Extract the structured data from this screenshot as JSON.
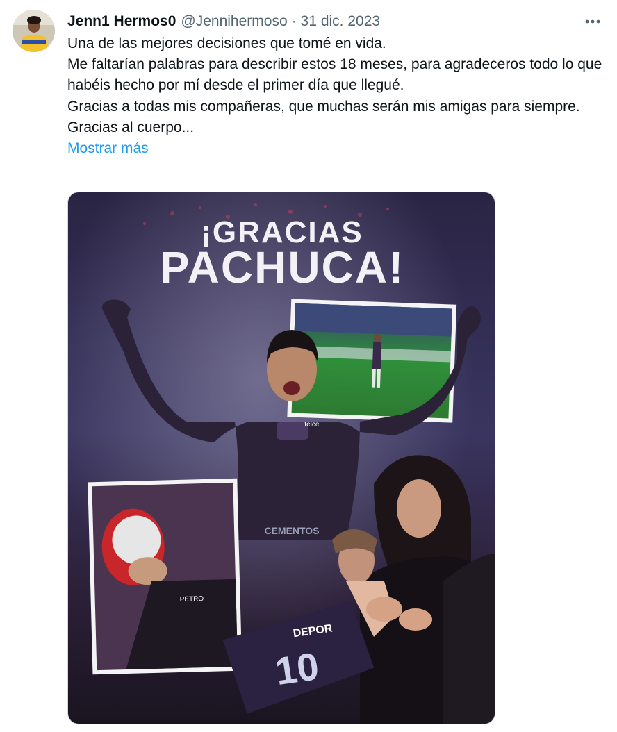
{
  "tweet": {
    "display_name": "Jenn1 Hermos0",
    "handle": "@Jennihermoso",
    "separator": "·",
    "date": "31 dic. 2023",
    "more_icon": "more-horizontal-icon",
    "paragraphs": [
      "Una de las mejores decisiones que tomé en vida.",
      "Me faltarían palabras para describir estos 18 meses, para agradeceros todo lo que habéis hecho por mí desde el primer día que llegué.",
      "Gracias a todas mis compañeras, que muchas serán mis amigas para siempre.",
      "Gracias al cuerpo..."
    ],
    "show_more_label": "Mostrar más",
    "image_text": {
      "line1": "¡GRACIAS",
      "line2": "PACHUCA!"
    },
    "jersey": {
      "sponsor_chest": "CEMENTOS",
      "sponsor_small": "telcel",
      "number": "10",
      "back_sponsor": "DEPOR"
    },
    "colors": {
      "text": "#0f1419",
      "secondary": "#536471",
      "link": "#1d9bf0",
      "photo_bg": "#2a2346",
      "jersey": "#2b2238"
    }
  }
}
